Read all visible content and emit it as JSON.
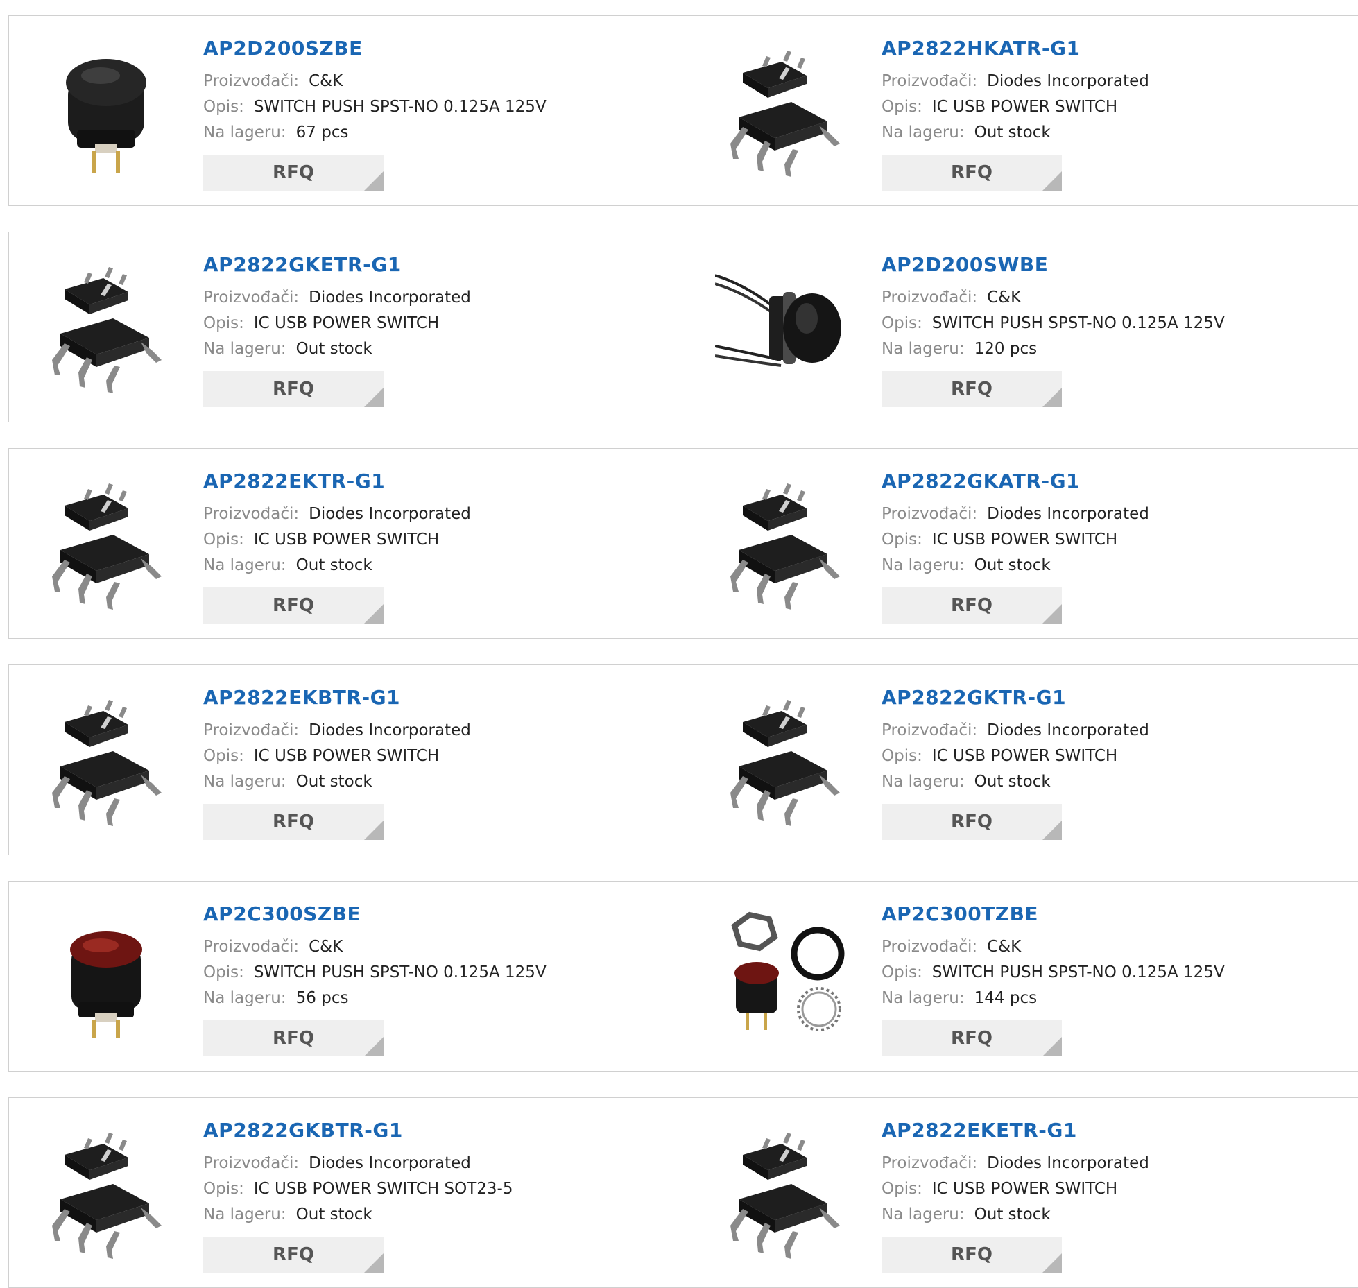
{
  "labels": {
    "manufacturer": "Proizvođači:",
    "description": "Opis:",
    "stock": "Na lageru:",
    "rfq": "RFQ"
  },
  "products": [
    {
      "part": "AP2D200SZBE",
      "manufacturer": "C&K",
      "description": "SWITCH PUSH SPST-NO 0.125A 125V",
      "stock": "67 pcs",
      "image": "push-switch-black-icon"
    },
    {
      "part": "AP2822HKATR-G1",
      "manufacturer": "Diodes Incorporated",
      "description": "IC USB POWER SWITCH",
      "stock": "Out stock",
      "image": "sot23-chip-icon"
    },
    {
      "part": "AP2822GKETR-G1",
      "manufacturer": "Diodes Incorporated",
      "description": "IC USB POWER SWITCH",
      "stock": "Out stock",
      "image": "sot23-chip-icon"
    },
    {
      "part": "AP2D200SWBE",
      "manufacturer": "C&K",
      "description": "SWITCH PUSH SPST-NO 0.125A 125V",
      "stock": "120 pcs",
      "image": "push-switch-wired-icon"
    },
    {
      "part": "AP2822EKTR-G1",
      "manufacturer": "Diodes Incorporated",
      "description": "IC USB POWER SWITCH",
      "stock": "Out stock",
      "image": "sot23-chip-icon"
    },
    {
      "part": "AP2822GKATR-G1",
      "manufacturer": "Diodes Incorporated",
      "description": "IC USB POWER SWITCH",
      "stock": "Out stock",
      "image": "sot23-chip-icon"
    },
    {
      "part": "AP2822EKBTR-G1",
      "manufacturer": "Diodes Incorporated",
      "description": "IC USB POWER SWITCH",
      "stock": "Out stock",
      "image": "sot23-chip-icon"
    },
    {
      "part": "AP2822GKTR-G1",
      "manufacturer": "Diodes Incorporated",
      "description": "IC USB POWER SWITCH",
      "stock": "Out stock",
      "image": "sot23-chip-icon"
    },
    {
      "part": "AP2C300SZBE",
      "manufacturer": "C&K",
      "description": "SWITCH PUSH SPST-NO 0.125A 125V",
      "stock": "56 pcs",
      "image": "push-switch-red-icon"
    },
    {
      "part": "AP2C300TZBE",
      "manufacturer": "C&K",
      "description": "SWITCH PUSH SPST-NO 0.125A 125V",
      "stock": "144 pcs",
      "image": "push-switch-kit-icon"
    },
    {
      "part": "AP2822GKBTR-G1",
      "manufacturer": "Diodes Incorporated",
      "description": "IC USB POWER SWITCH SOT23-5",
      "stock": "Out stock",
      "image": "sot23-chip-icon"
    },
    {
      "part": "AP2822EKETR-G1",
      "manufacturer": "Diodes Incorporated",
      "description": "IC USB POWER SWITCH",
      "stock": "Out stock",
      "image": "sot23-chip-icon"
    }
  ]
}
